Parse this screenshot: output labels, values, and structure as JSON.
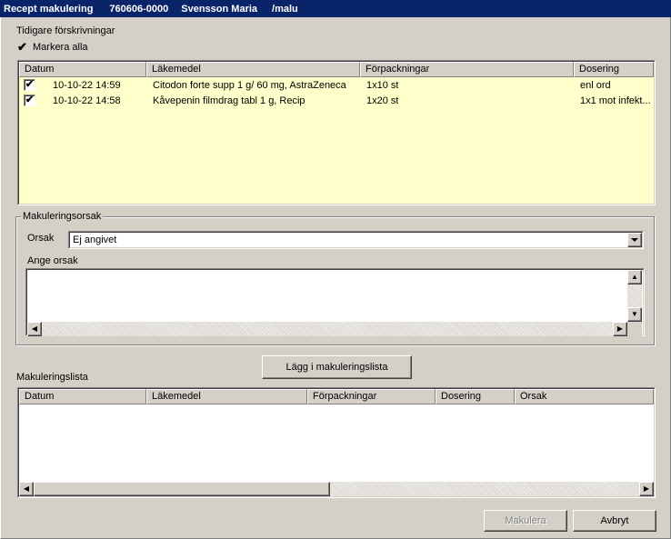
{
  "window": {
    "title_segments": [
      "Recept makulering",
      "760606-0000",
      "Svensson Maria",
      "/malu"
    ]
  },
  "previous": {
    "section_label": "Tidigare förskrivningar",
    "select_all_label": "Markera alla",
    "select_all_checked": true,
    "columns": [
      "Datum",
      "Läkemedel",
      "Förpackningar",
      "Dosering"
    ],
    "rows": [
      {
        "checked": true,
        "date": "10-10-22 14:59",
        "drug": "Citodon forte supp 1 g/ 60 mg, AstraZeneca",
        "package": "1x10 st",
        "dosage": "enl ord"
      },
      {
        "checked": true,
        "date": "10-10-22 14:58",
        "drug": "Kåvepenin filmdrag tabl 1 g, Recip",
        "package": "1x20 st",
        "dosage": "1x1 mot infekt..."
      }
    ],
    "background": "#ffffcc"
  },
  "reason_group": {
    "title": "Makuleringsorsak",
    "reason_label": "Orsak",
    "reason_value": "Ej angivet",
    "enter_reason_label": "Ange orsak",
    "enter_reason_value": ""
  },
  "add_button_label": "Lägg i makuleringslista",
  "cancel_list": {
    "label": "Makuleringslista",
    "columns": [
      "Datum",
      "Läkemedel",
      "Förpackningar",
      "Dosering",
      "Orsak"
    ]
  },
  "buttons": {
    "makulera": "Makulera",
    "avbryt": "Avbryt"
  },
  "icons": {
    "checkmark": "✔",
    "dropdown": "chevron-down-icon",
    "scroll_up": "▲",
    "scroll_down": "▼",
    "scroll_left": "◀",
    "scroll_right": "▶"
  }
}
